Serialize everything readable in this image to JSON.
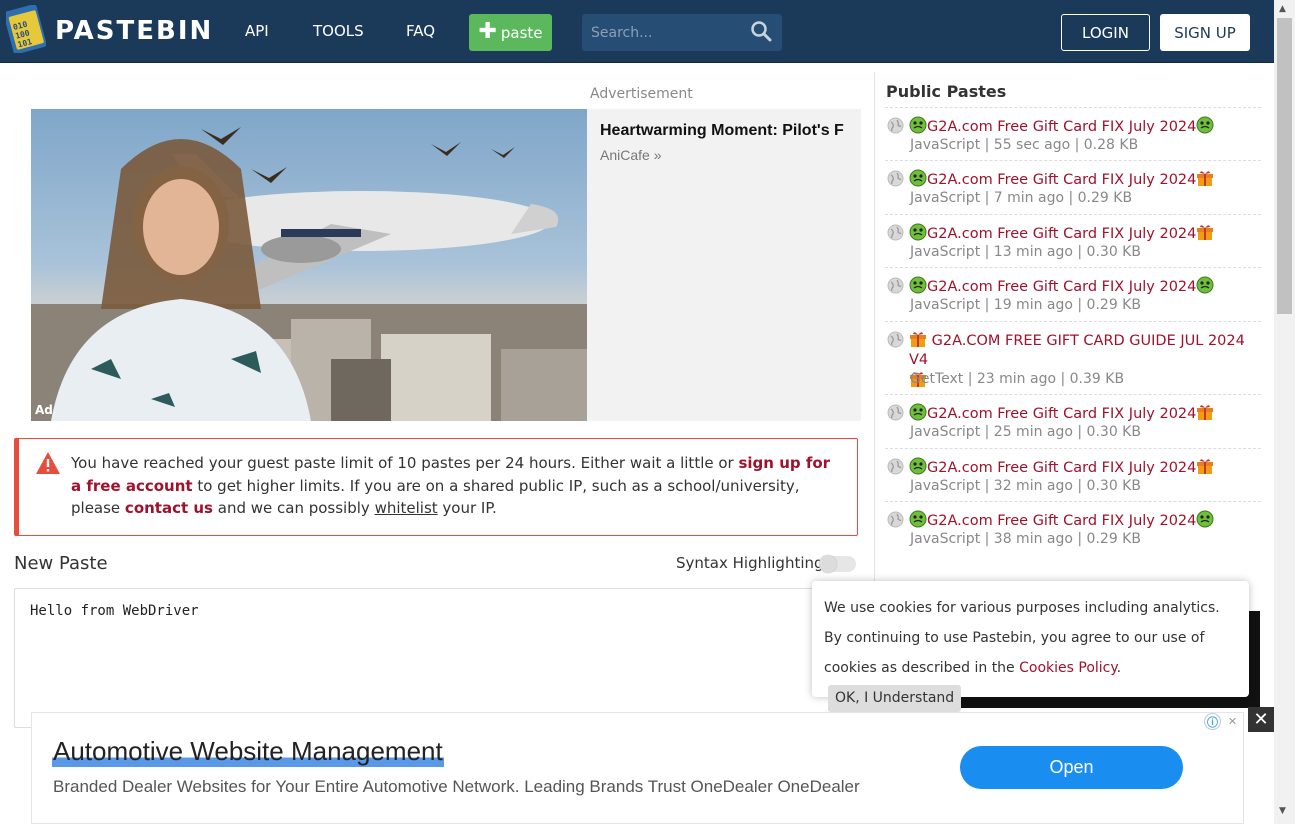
{
  "header": {
    "logo_text": "PASTEBIN",
    "nav": [
      "API",
      "TOOLS",
      "FAQ"
    ],
    "paste_button": "paste",
    "search_placeholder": "Search...",
    "login": "LOGIN",
    "signup": "SIGN UP"
  },
  "ad": {
    "label": "Advertisement",
    "tag": "Ad",
    "headline": "Heartwarming Moment: Pilot's F",
    "source": "AniCafe »"
  },
  "warning": {
    "part1": "You have reached your guest paste limit of 10 pastes per 24 hours. Either wait a little or ",
    "link1": "sign up for a free account",
    "part2": " to get higher limits. If you are on a shared public IP, such as a school/university, please ",
    "link2": "contact us",
    "part3": " and we can possibly ",
    "link3": "whitelist",
    "part4": " your IP."
  },
  "editor": {
    "title": "New Paste",
    "syntax_label": "Syntax Highlighting",
    "syntax_enabled": false,
    "content": "Hello from WebDriver"
  },
  "public_pastes": {
    "title": "Public Pastes",
    "items": [
      {
        "title": "G2A.com Free Gift Card FIX July 2024",
        "lead_emoji": "green-face",
        "trail_emoji": "green-face",
        "meta": "JavaScript | 55 sec ago | 0.28 KB"
      },
      {
        "title": "G2A.com Free Gift Card FIX July 2024",
        "lead_emoji": "green-face",
        "trail_emoji": "gift",
        "meta": "JavaScript | 7 min ago | 0.29 KB"
      },
      {
        "title": "G2A.com Free Gift Card FIX July 2024",
        "lead_emoji": "green-face",
        "trail_emoji": "gift",
        "meta": "JavaScript | 13 min ago | 0.30 KB"
      },
      {
        "title": "G2A.com Free Gift Card FIX July 2024",
        "lead_emoji": "green-face",
        "trail_emoji": "green-face",
        "meta": "JavaScript | 19 min ago | 0.29 KB"
      },
      {
        "title": " G2A.COM FREE GIFT CARD GUIDE JUL 2024 V4",
        "lead_emoji": "gift",
        "trail_emoji": "gift",
        "meta": "GetText | 23 min ago | 0.39 KB"
      },
      {
        "title": "G2A.com Free Gift Card FIX July 2024",
        "lead_emoji": "green-face",
        "trail_emoji": "gift",
        "meta": "JavaScript | 25 min ago | 0.30 KB"
      },
      {
        "title": "G2A.com Free Gift Card FIX July 2024",
        "lead_emoji": "green-face",
        "trail_emoji": "gift",
        "meta": "JavaScript | 32 min ago | 0.30 KB"
      },
      {
        "title": "G2A.com Free Gift Card FIX July 2024",
        "lead_emoji": "green-face",
        "trail_emoji": "green-face",
        "meta": "JavaScript | 38 min ago | 0.29 KB"
      }
    ]
  },
  "cookie": {
    "text": "We use cookies for various purposes including analytics. By continuing to use Pastebin, you agree to our use of cookies as described in the ",
    "link": "Cookies Policy",
    "after_link": ".",
    "button": "OK, I Understand"
  },
  "bottom_ad": {
    "title": "Automotive Website Management",
    "description": "Branded Dealer Websites for Your Entire Automotive Network. Leading Brands Trust OneDealer OneDealer",
    "button": "Open",
    "close": "✕",
    "info": "ⓘ",
    "x": "✕"
  },
  "colors": {
    "header_bg": "#1b3a5a",
    "accent_red": "#a0112c",
    "paste_green": "#5cb85c",
    "warning_red": "#e74c3c",
    "open_blue": "#1a8df0"
  }
}
